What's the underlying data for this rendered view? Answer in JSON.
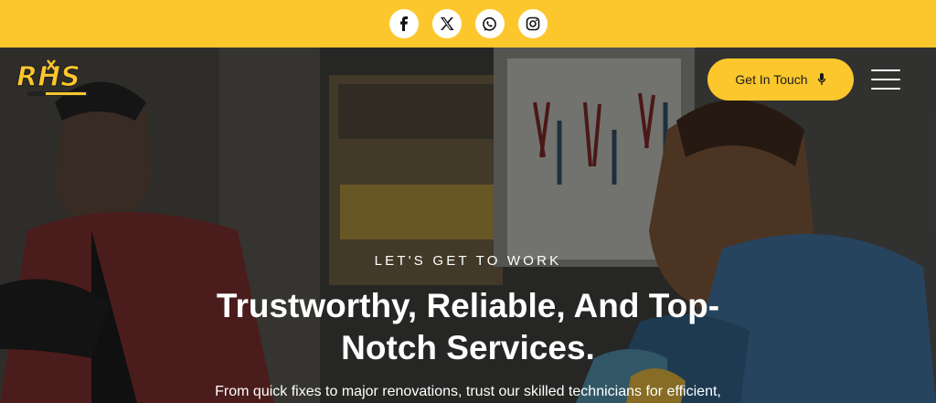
{
  "top_bar": {
    "social_links": [
      {
        "name": "facebook-icon",
        "glyph": "f"
      },
      {
        "name": "x-twitter-icon",
        "glyph": "X"
      },
      {
        "name": "whatsapp-icon",
        "glyph": "whatsapp"
      },
      {
        "name": "instagram-icon",
        "glyph": "instagram"
      }
    ],
    "background_color": "#fcc72c"
  },
  "header": {
    "logo_text": "RHS",
    "cta_label": "Get In Touch",
    "cta_icon": "microphone-icon",
    "menu_icon": "hamburger-menu-icon"
  },
  "hero": {
    "eyebrow": "LET'S GET TO WORK",
    "headline": "Trustworthy, Reliable, And Top-Notch Services.",
    "subtext": "From quick fixes to major renovations, trust our skilled technicians for efficient,",
    "image_description_icon": "workshop-photo"
  },
  "colors": {
    "accent": "#fcc72c",
    "text_on_dark": "#ffffff",
    "text_on_accent": "#1b1b1b"
  }
}
